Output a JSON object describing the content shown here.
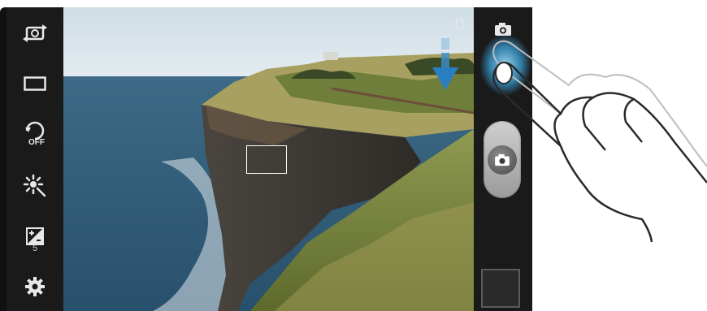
{
  "left_toolbar": {
    "items": [
      {
        "name": "switch-camera",
        "icon": "switch-camera-icon"
      },
      {
        "name": "recording-mode",
        "icon": "frame-icon"
      },
      {
        "name": "timer",
        "icon": "timer-off-icon",
        "label": "OFF"
      },
      {
        "name": "effects",
        "icon": "effects-icon"
      },
      {
        "name": "exposure",
        "icon": "exposure-icon",
        "value": "5"
      },
      {
        "name": "settings",
        "icon": "gear-icon"
      }
    ]
  },
  "right_toolbar": {
    "mode_icon": "camera-icon",
    "shutter_icon": "camera-icon",
    "thumbnail": "last-photo-thumbnail"
  },
  "viewfinder": {
    "gesture_hint": "drag-down-arrow"
  },
  "colors": {
    "panel_bg": "#1a1a1a",
    "highlight": "#3aa0d8",
    "arrow": "#2a7fc0"
  }
}
